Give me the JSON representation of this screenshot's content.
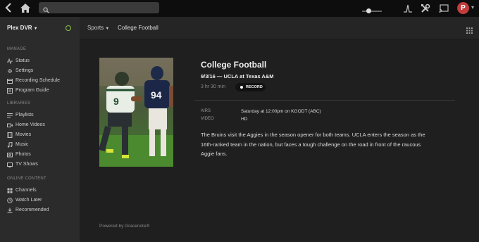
{
  "search": {
    "placeholder": ""
  },
  "user": {
    "initial": "P"
  },
  "sidebar": {
    "server_name": "Plex DVR",
    "sections": {
      "manage": "MANAGE",
      "libraries": "LIBRARIES",
      "online": "ONLINE CONTENT"
    },
    "manage_items": [
      {
        "label": "Status",
        "icon": "pulse-icon"
      },
      {
        "label": "Settings",
        "icon": "gear-icon"
      },
      {
        "label": "Recording Schedule",
        "icon": "calendar-icon"
      },
      {
        "label": "Program Guide",
        "icon": "guide-icon"
      }
    ],
    "library_items": [
      {
        "label": "Playlists",
        "icon": "playlist-icon"
      },
      {
        "label": "Home Videos",
        "icon": "camera-icon"
      },
      {
        "label": "Movies",
        "icon": "film-icon"
      },
      {
        "label": "Music",
        "icon": "music-note-icon"
      },
      {
        "label": "Photos",
        "icon": "photo-icon"
      },
      {
        "label": "TV Shows",
        "icon": "tv-icon"
      }
    ],
    "online_items": [
      {
        "label": "Channels",
        "icon": "channels-icon"
      },
      {
        "label": "Watch Later",
        "icon": "clock-icon"
      },
      {
        "label": "Recommended",
        "icon": "download-icon"
      }
    ]
  },
  "breadcrumb": {
    "category": "Sports",
    "current": "College Football"
  },
  "detail": {
    "title": "College Football",
    "subtitle": "9/3/16 — UCLA at Texas A&M",
    "duration": "3 hr 30 min",
    "record_label": "RECORD",
    "airs_key": "AIRS",
    "airs_value": "Saturday at 12:00pm on KGODT (ABC)",
    "video_key": "VIDEO",
    "video_value": "HD",
    "summary": "The Bruins visit the Aggies in the season opener for both teams. UCLA enters the season as the 16th-ranked team in the nation, but faces a tough challenge on the road in front of the raucous Aggie fans.",
    "poster_jersey_left": "9",
    "poster_jersey_right": "94"
  },
  "footer": {
    "powered_by": "Powered by Gracenote®"
  },
  "colors": {
    "accent_status": "#8bc34a",
    "avatar": "#c23c3c",
    "background": "#1f1f1f",
    "sidebar": "#2b2b2b"
  }
}
